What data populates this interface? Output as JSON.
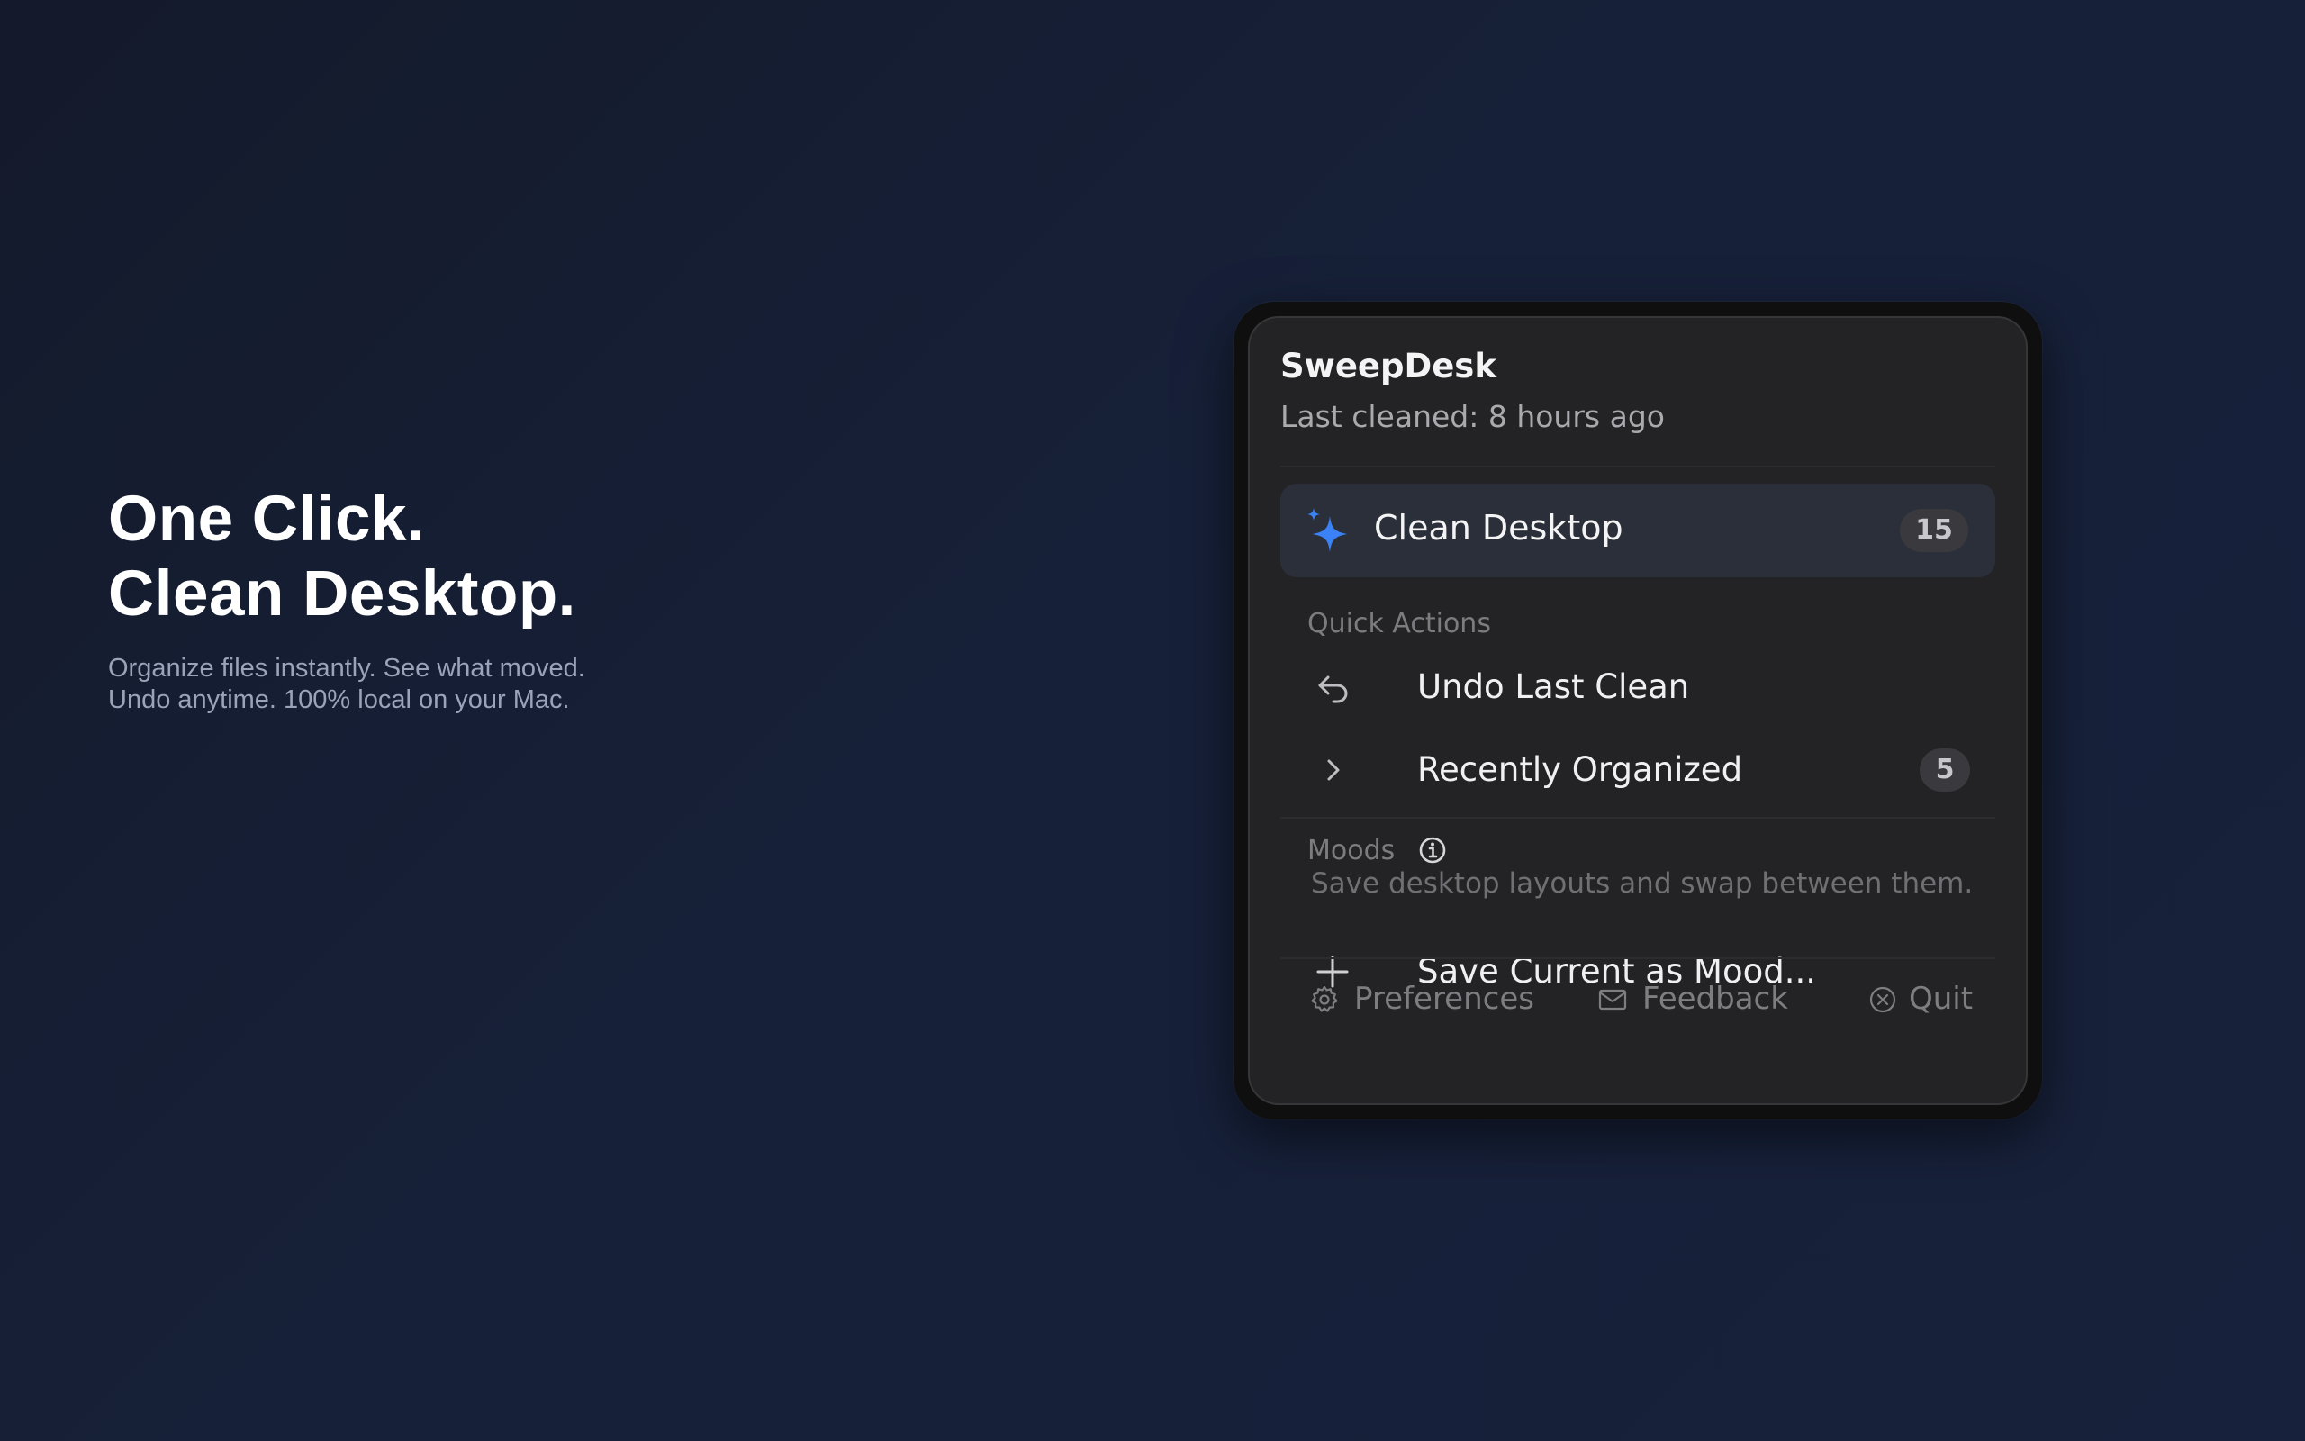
{
  "hero": {
    "line1": "One Click.",
    "line2": "Clean Desktop.",
    "sub_line1": "Organize files instantly. See what moved.",
    "sub_line2": "Undo anytime. 100% local on your Mac."
  },
  "panel": {
    "app_name": "SweepDesk",
    "status": "Last cleaned: 8 hours ago",
    "primary_action": {
      "label": "Clean Desktop",
      "count": "15",
      "icon": "sparkle-icon"
    },
    "quick_actions": {
      "heading": "Quick Actions",
      "items": [
        {
          "label": "Undo Last Clean",
          "icon": "undo-arrow-icon",
          "count": ""
        },
        {
          "label": "Recently Organized",
          "icon": "chevron-right-icon",
          "count": "5"
        }
      ]
    },
    "moods": {
      "heading": "Moods",
      "info_icon": "info-icon",
      "help": "Save desktop layouts and swap between them.",
      "save_label": "Save Current as Mood..."
    },
    "footer": {
      "preferences": "Preferences",
      "feedback": "Feedback",
      "quit": "Quit"
    }
  },
  "colors": {
    "accent": "#3b82f6",
    "panel_bg": "#232325",
    "page_bg": "#162038"
  }
}
